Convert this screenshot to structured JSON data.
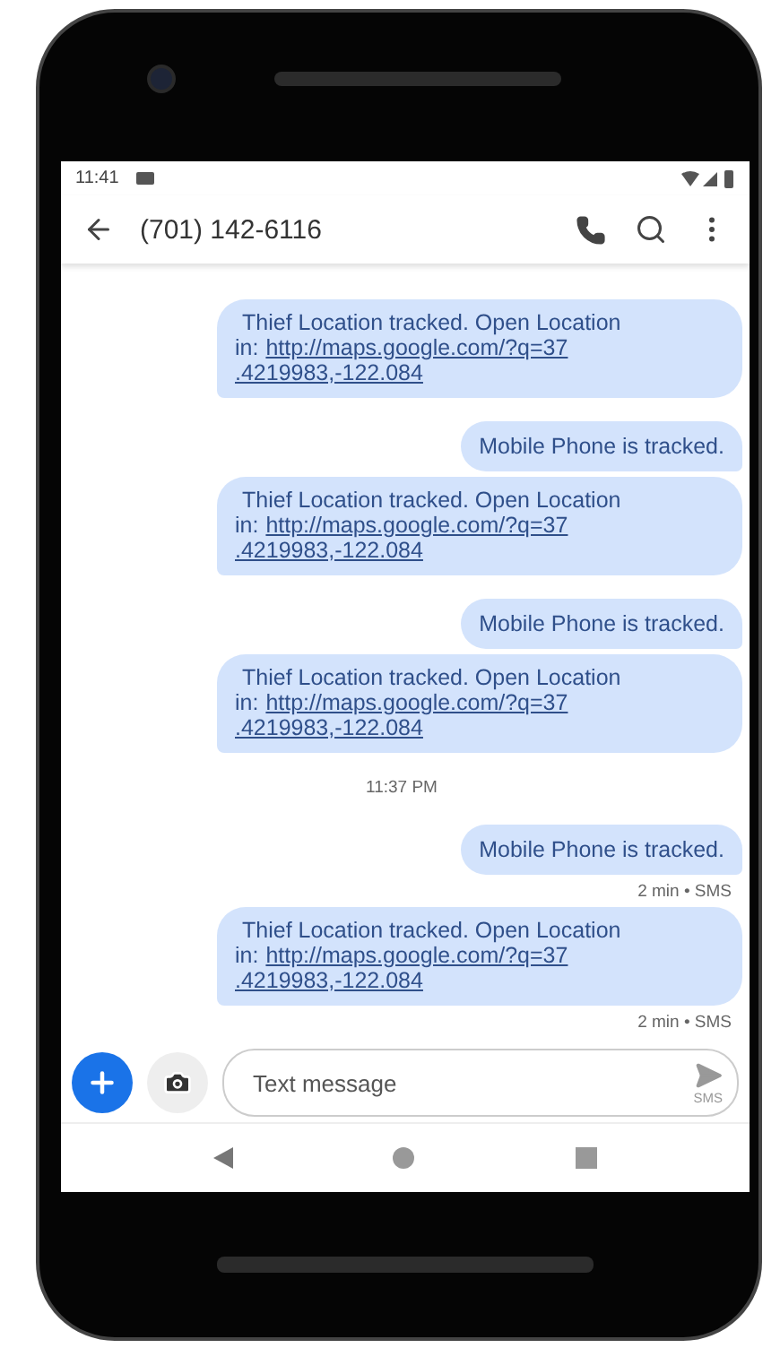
{
  "status_bar": {
    "time": "11:41"
  },
  "app_bar": {
    "title": "(701) 142-6116"
  },
  "messages": [
    {
      "kind": "incoming",
      "text": "Thief Location tracked. Open Location",
      "prefix": "in:",
      "link_lines": [
        "http://maps.google.com/?q=37",
        ".4219983,-122.084"
      ]
    },
    {
      "kind": "outgoing",
      "text": "Mobile Phone is tracked."
    },
    {
      "kind": "incoming",
      "text": "Thief Location tracked. Open Location",
      "prefix": "in:",
      "link_lines": [
        "http://maps.google.com/?q=37",
        ".4219983,-122.084"
      ]
    },
    {
      "kind": "outgoing",
      "text": "Mobile Phone is tracked."
    },
    {
      "kind": "incoming",
      "text": "Thief Location tracked. Open Location",
      "prefix": "in:",
      "link_lines": [
        "http://maps.google.com/?q=37",
        ".4219983,-122.084"
      ]
    },
    {
      "kind": "timestamp",
      "text": "11:37 PM"
    },
    {
      "kind": "outgoing",
      "text": "Mobile Phone is tracked.",
      "meta": "2 min • SMS"
    },
    {
      "kind": "incoming",
      "text": "Thief Location tracked. Open Location",
      "prefix": "in:",
      "link_lines": [
        "http://maps.google.com/?q=37",
        ".4219983,-122.084"
      ],
      "meta": "2 min • SMS"
    }
  ],
  "composer": {
    "placeholder": "Text message",
    "send_label": "SMS"
  }
}
